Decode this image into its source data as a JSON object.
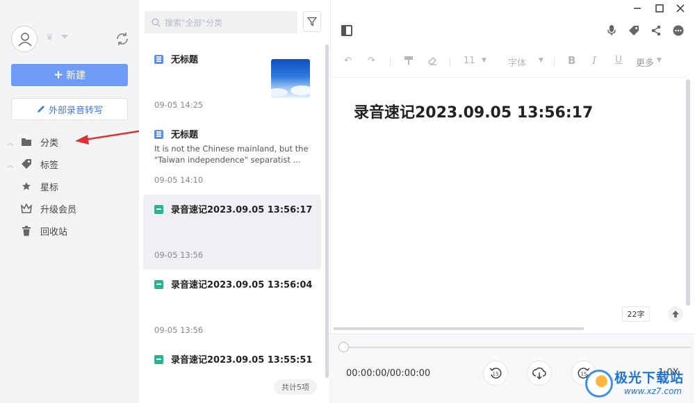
{
  "sidebar": {
    "new_label": "新建",
    "external_label": "外部录音转写",
    "nav": [
      {
        "label": "分类",
        "icon": "folder-icon",
        "expandable": true
      },
      {
        "label": "标签",
        "icon": "tag-icon",
        "expandable": true
      },
      {
        "label": "星标",
        "icon": "star-icon",
        "expandable": false
      },
      {
        "label": "升级会员",
        "icon": "crown-icon",
        "expandable": false
      },
      {
        "label": "回收站",
        "icon": "trash-icon",
        "expandable": false
      }
    ]
  },
  "list": {
    "search_placeholder": "搜索\"全部\"分类",
    "total": "共计5项",
    "notes": [
      {
        "title": "无标题",
        "type": "doc",
        "snippet": "",
        "time": "09-05 14:25",
        "has_thumb": true
      },
      {
        "title": "无标题",
        "type": "doc",
        "snippet": "It is not the Chinese mainland, but the \"Taiwan independence\" separatist ...",
        "time": "09-05 14:10",
        "has_thumb": false
      },
      {
        "title": "录音速记2023.09.05 13:56:17",
        "type": "audio",
        "snippet": "",
        "time": "09-05 13:56",
        "active": true
      },
      {
        "title": "录音速记2023.09.05 13:56:04",
        "type": "audio",
        "snippet": "",
        "time": "09-05 13:56"
      },
      {
        "title": "录音速记2023.09.05 13:55:51",
        "type": "audio",
        "snippet": "",
        "time": ""
      }
    ]
  },
  "editor": {
    "toolbar": {
      "font_size": "11",
      "font": "字体",
      "more": "更多"
    },
    "title": "录音速记2023.09.05 13:56:17",
    "word_count": "22字"
  },
  "player": {
    "time": "00:00:00/00:00:00",
    "rewind_label": "15",
    "forward_label": "15",
    "speed": "1.0X",
    "progress": 0
  },
  "watermark": {
    "text": "极光下载站",
    "url": "www.xz7.com"
  },
  "colors": {
    "accent": "#6d9bf6",
    "audio_icon": "#2bb48f",
    "doc_icon": "#5b8def",
    "arrow": "#e03030"
  }
}
